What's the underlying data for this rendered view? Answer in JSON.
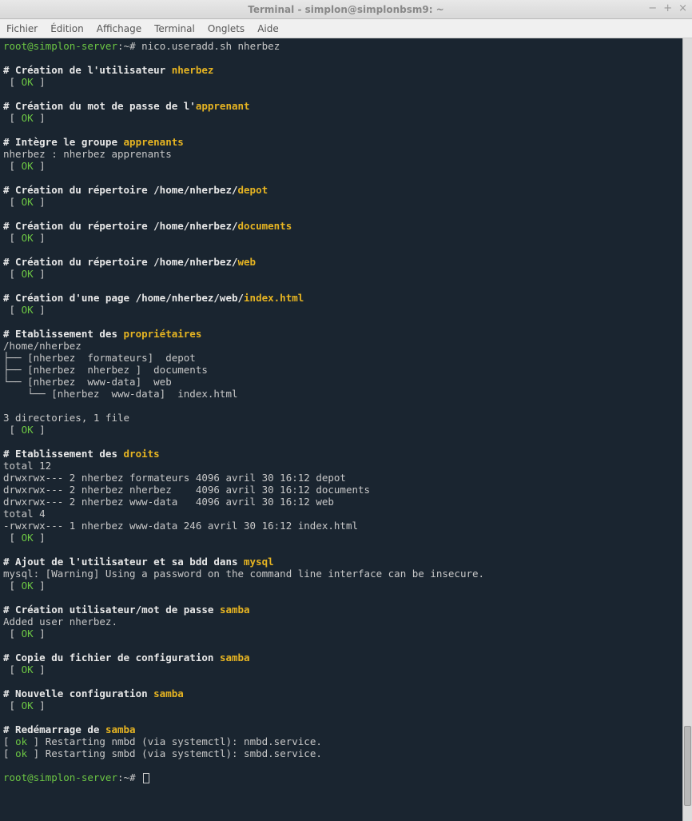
{
  "window": {
    "title": "Terminal - simplon@simplonbsm9: ~"
  },
  "menu": {
    "file": "Fichier",
    "edit": "Édition",
    "view": "Affichage",
    "terminal": "Terminal",
    "tabs": "Onglets",
    "help": "Aide"
  },
  "prompt": {
    "user_host": "root@simplon-server",
    "cwd": "~",
    "symbol": "#",
    "command": "nico.useradd.sh nherbez"
  },
  "ok": "OK",
  "ok_lower": "ok",
  "sections": {
    "create_user": {
      "prefix": "# Création de l'utilisateur ",
      "highlight": "nherbez"
    },
    "create_pw": {
      "prefix": "# Création du mot de passe de l'",
      "highlight": "apprenant"
    },
    "group": {
      "prefix": "# Intègre le groupe ",
      "highlight": "apprenants",
      "detail": "nherbez : nherbez apprenants"
    },
    "dir_depot": {
      "prefix": "# Création du répertoire /home/nherbez/",
      "highlight": "depot"
    },
    "dir_docs": {
      "prefix": "# Création du répertoire /home/nherbez/",
      "highlight": "documents"
    },
    "dir_web": {
      "prefix": "# Création du répertoire /home/nherbez/",
      "highlight": "web"
    },
    "page": {
      "prefix": "# Création d'une page /home/nherbez/web/",
      "highlight": "index.html"
    },
    "owners": {
      "prefix": "# Etablissement des ",
      "highlight": "propriétaires",
      "path": "/home/nherbez",
      "tree": [
        "├── [nherbez  formateurs]  depot",
        "├── [nherbez  nherbez ]  documents",
        "└── [nherbez  www-data]  web",
        "    └── [nherbez  www-data]  index.html"
      ],
      "summary": "3 directories, 1 file"
    },
    "rights": {
      "prefix": "# Etablissement des ",
      "highlight": "droits",
      "lines": [
        "total 12",
        "drwxrwx--- 2 nherbez formateurs 4096 avril 30 16:12 depot",
        "drwxrwx--- 2 nherbez nherbez    4096 avril 30 16:12 documents",
        "drwxrwx--- 2 nherbez www-data   4096 avril 30 16:12 web",
        "total 4",
        "-rwxrwx--- 1 nherbez www-data 246 avril 30 16:12 index.html"
      ]
    },
    "mysql": {
      "prefix": "# Ajout de l'utilisateur et sa bdd dans ",
      "highlight": "mysql",
      "detail": "mysql: [Warning] Using a password on the command line interface can be insecure."
    },
    "samba_user": {
      "prefix": "# Création utilisateur/mot de passe ",
      "highlight": "samba",
      "detail": "Added user nherbez."
    },
    "samba_copy": {
      "prefix": "# Copie du fichier de configuration ",
      "highlight": "samba"
    },
    "samba_conf": {
      "prefix": "# Nouvelle configuration ",
      "highlight": "samba"
    },
    "samba_restart": {
      "prefix": "# Redémarrage de ",
      "highlight": "samba",
      "lines": [
        "Restarting nmbd (via systemctl): nmbd.service.",
        "Restarting smbd (via systemctl): smbd.service."
      ]
    }
  }
}
